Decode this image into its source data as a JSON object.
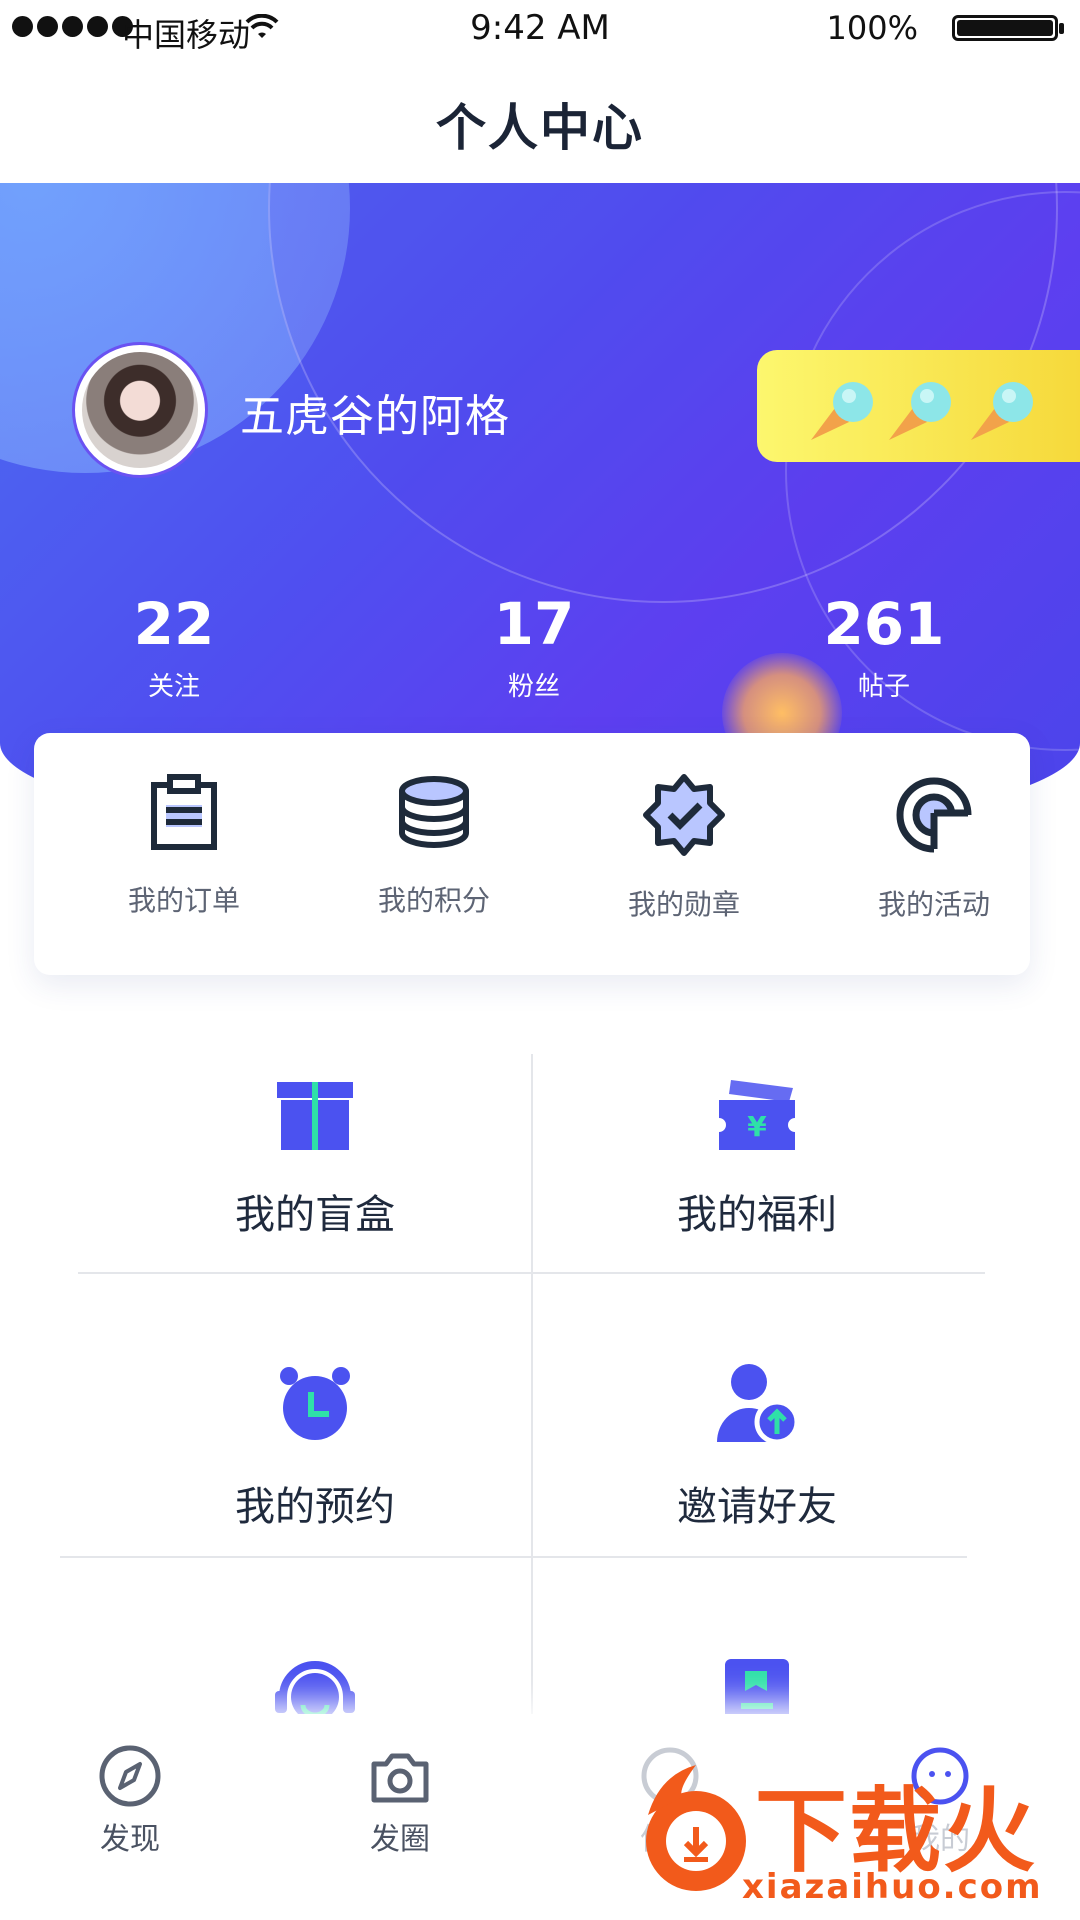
{
  "status_bar": {
    "carrier": "中国移动",
    "time": "9:42 AM",
    "battery": "100%"
  },
  "nav": {
    "title": "个人中心"
  },
  "profile": {
    "username": "五虎谷的阿格"
  },
  "stats": [
    {
      "value": "22",
      "label": "关注"
    },
    {
      "value": "17",
      "label": "粉丝"
    },
    {
      "value": "261",
      "label": "帖子"
    }
  ],
  "quick_actions": [
    {
      "label": "我的订单",
      "icon": "clipboard-icon"
    },
    {
      "label": "我的积分",
      "icon": "database-coins-icon"
    },
    {
      "label": "我的勋章",
      "icon": "medal-badge-icon"
    },
    {
      "label": "我的活动",
      "icon": "activity-target-icon"
    }
  ],
  "services": [
    {
      "label": "我的盲盒",
      "icon": "gift-box-icon"
    },
    {
      "label": "我的福利",
      "icon": "coupon-yen-icon"
    },
    {
      "label": "我的预约",
      "icon": "alarm-clock-icon"
    },
    {
      "label": "邀请好友",
      "icon": "user-invite-icon"
    },
    {
      "label": "",
      "icon": "customer-service-headset-icon"
    },
    {
      "label": "",
      "icon": "contacts-book-icon"
    }
  ],
  "tabbar": [
    {
      "label": "发现",
      "icon": "compass-icon"
    },
    {
      "label": "发圈",
      "icon": "camera-icon"
    },
    {
      "label": "信息",
      "icon": "message-icon"
    },
    {
      "label": "我的",
      "icon": "profile-icon"
    }
  ],
  "watermark": {
    "brand": "下载火",
    "url": "xiazaihuo.com"
  },
  "colors": {
    "primary": "#4A4FF0",
    "accent_green": "#2FE0A8",
    "badge_yellow": "#F8E04A",
    "watermark_orange": "#F25A1B"
  }
}
